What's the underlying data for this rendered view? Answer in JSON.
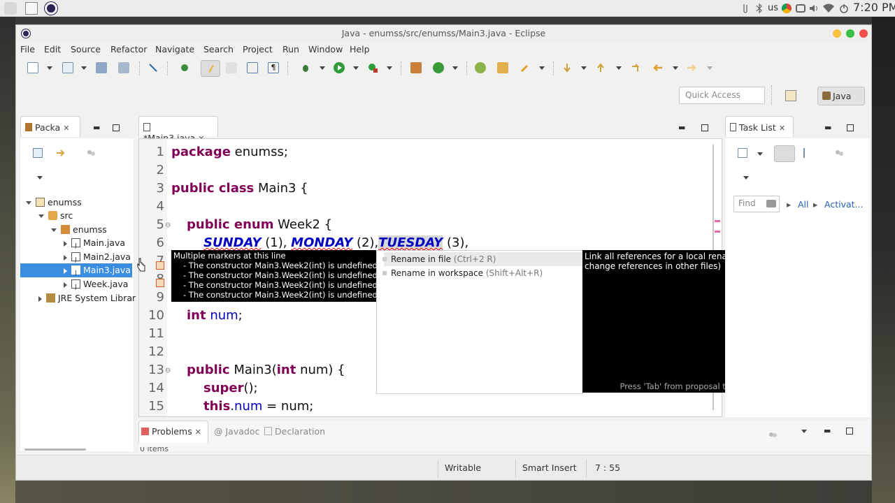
{
  "system": {
    "locale": "us",
    "clock": "7:20 PM"
  },
  "window": {
    "title": "Java - enumss/src/enumss/Main3.java - Eclipse"
  },
  "menu": [
    "File",
    "Edit",
    "Source",
    "Refactor",
    "Navigate",
    "Search",
    "Project",
    "Run",
    "Window",
    "Help"
  ],
  "toolbar": {
    "quick_access_placeholder": "Quick Access",
    "perspective": "Java"
  },
  "package_explorer": {
    "tab_label": "Packa",
    "tree": [
      {
        "label": "enumss",
        "level": 0,
        "expanded": true,
        "icon": "project-icon"
      },
      {
        "label": "src",
        "level": 1,
        "expanded": true,
        "icon": "source-folder-icon"
      },
      {
        "label": "enumss",
        "level": 2,
        "expanded": true,
        "icon": "package-icon"
      },
      {
        "label": "Main.java",
        "level": 3,
        "expanded": false,
        "icon": "java-file-icon"
      },
      {
        "label": "Main2.java",
        "level": 3,
        "expanded": false,
        "icon": "java-file-icon"
      },
      {
        "label": "Main3.java",
        "level": 3,
        "expanded": false,
        "icon": "java-file-icon",
        "selected": true
      },
      {
        "label": "Week.java",
        "level": 3,
        "expanded": false,
        "icon": "java-file-icon"
      },
      {
        "label": "JRE System Librar",
        "level": 1,
        "expanded": false,
        "icon": "library-icon"
      }
    ]
  },
  "editor": {
    "tab_label": "*Main3.java",
    "lines": [
      "1",
      "2",
      "3",
      "4",
      "5",
      "6",
      "7",
      "8",
      "9",
      "10",
      "11",
      "12",
      "13",
      "14",
      "15"
    ],
    "code": {
      "l1_kw": "package",
      "l1_rest": " enumss;",
      "l3_kw": "public class",
      "l3_rest": " Main3 {",
      "l5_kw": "public enum",
      "l5_rest": " Week2 {",
      "l6_c1": "SUNDAY",
      "l6_a1": " (1), ",
      "l6_c2": "MONDAY",
      "l6_a2": " (2),",
      "l6_c3": "TUESDAY",
      "l6_a3": " (3),",
      "l10_kw": "int",
      "l10_field": " num",
      "l10_rest": ";",
      "l13_kw1": "public",
      "l13_a": " Main3(",
      "l13_kw2": "int",
      "l13_b": " num) {",
      "l14_kw": "super",
      "l14_rest": "();",
      "l15_kw": "this",
      "l15_a": ".",
      "l15_field": "num",
      "l15_rest": " = num;"
    },
    "markers_tooltip": {
      "title": "Multiple markers at this line",
      "items": [
        "- The constructor Main3.Week2(int) is undefined",
        "- The constructor Main3.Week2(int) is undefined",
        "- The constructor Main3.Week2(int) is undefined",
        "- The constructor Main3.Week2(int) is undefined"
      ]
    },
    "proposals": {
      "rename_file_label": "Rename in file",
      "rename_file_shortcut": "(Ctrl+2 R)",
      "rename_workspace_label": "Rename in workspace",
      "rename_workspace_shortcut": "(Shift+Alt+R)"
    },
    "proposal_info": {
      "text": "Link all references for a local rename (does not change references in other files)",
      "footer": "Press 'Tab' from proposal table or click for focus"
    }
  },
  "task_list": {
    "tab_label": "Task List",
    "find_placeholder": "Find",
    "all_label": "All",
    "activate_label": "Activat..."
  },
  "bottom_panel": {
    "tabs": [
      "Problems",
      "Javadoc",
      "Declaration"
    ],
    "items_text": "0 items"
  },
  "status": {
    "writable": "Writable",
    "insert_mode": "Smart Insert",
    "position": "7 : 55"
  },
  "colors": {
    "keyword": "#7f0055",
    "enum_constant": "#0000c0",
    "selection": "#3b8de0"
  }
}
